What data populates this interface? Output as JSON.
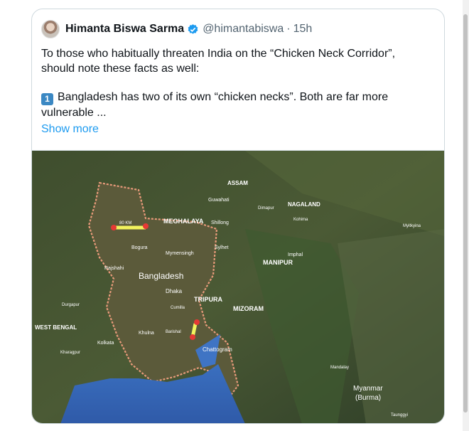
{
  "tweet": {
    "author_name": "Himanta Biswa Sarma",
    "handle": "@himantabiswa",
    "separator": "·",
    "time": "15h",
    "line1": "To those who habitually threaten India on the “Chicken Neck Corridor”,",
    "line2": "should note these facts as well:",
    "point_number": "1",
    "point_line1": "Bangladesh has two of its own “chicken necks”. Both are far more",
    "point_line2": "vulnerable ...",
    "show_more": "Show more"
  },
  "map": {
    "labels": {
      "bangladesh": "Bangladesh",
      "meghalaya": "MEGHALAYA",
      "assam": "ASSAM",
      "nagaland": "NAGALAND",
      "manipur": "MANIPUR",
      "tripura": "TRIPURA",
      "mizoram": "MIZORAM",
      "west_bengal": "WEST BENGAL",
      "myanmar": "Myanmar",
      "burma": "(Burma)",
      "dhaka": "Dhaka",
      "chattogram": "Chattogram",
      "khulna": "Khulna",
      "kolkata": "Kolkata",
      "rajshahi": "Rajshahi",
      "bogura": "Bogura",
      "mymensingh": "Mymensingh",
      "sylhet": "Sylhet",
      "shillong": "Shillong",
      "guwahati": "Guwahati",
      "imphal": "Imphal",
      "kohima": "Kohima",
      "durgapur": "Durgapur",
      "kharagpur": "Kharagpur",
      "cumilla": "Cumilla",
      "barishal": "Barishal",
      "dimapur": "Dimapur",
      "mandalay": "Mandalay",
      "taunggyi": "Taunggyi",
      "myitkyina": "Myitkyina",
      "corridor_label": "80 KM"
    }
  }
}
